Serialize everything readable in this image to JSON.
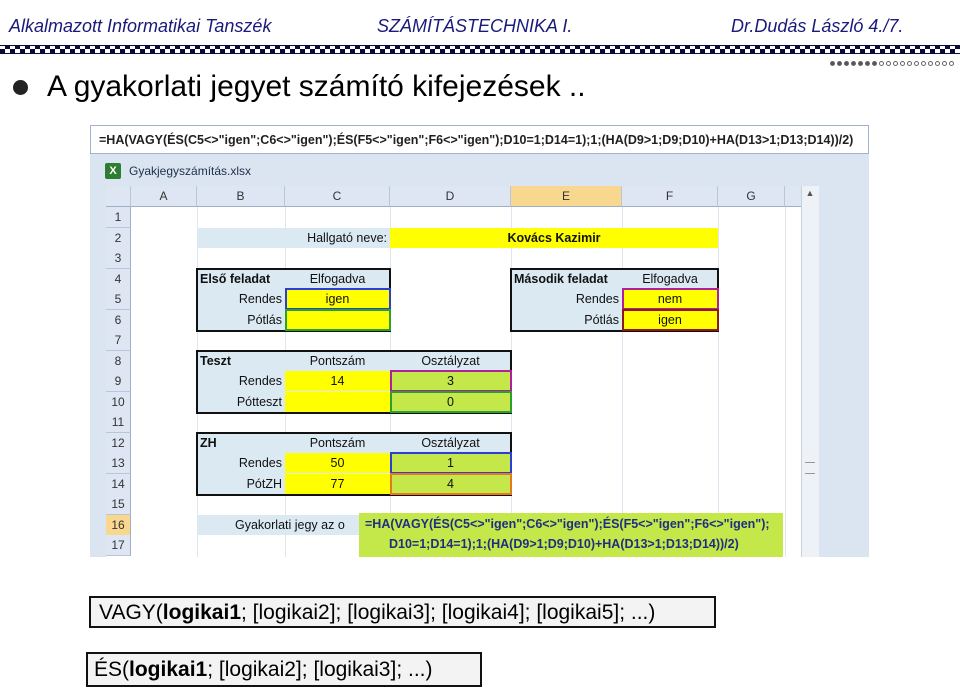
{
  "header": {
    "left": "Alkalmazott Informatikai Tanszék",
    "center": "SZÁMÍTÁSTECHNIKA I.",
    "right": "Dr.Dudás László   4./7."
  },
  "slide_title": "A gyakorlati jegyet számító kifejezések ..",
  "excel": {
    "formula_bar": "=HA(VAGY(ÉS(C5<>\"igen\";C6<>\"igen\");ÉS(F5<>\"igen\";F6<>\"igen\");D10=1;D14=1);1;(HA(D9>1;D9;D10)+HA(D13>1;D13;D14))/2)",
    "window_title": "Gyakjegyszámítás.xlsx",
    "columns": [
      "A",
      "B",
      "C",
      "D",
      "E",
      "F",
      "G"
    ],
    "rows": [
      "1",
      "2",
      "3",
      "4",
      "5",
      "6",
      "7",
      "8",
      "9",
      "10",
      "11",
      "12",
      "13",
      "14",
      "15",
      "16",
      "17"
    ],
    "cells": {
      "student_label": "Hallgató neve:",
      "student_name": "Kovács Kazimir",
      "first_task": "Első feladat",
      "accepted": "Elfogadva",
      "regular": "Rendes",
      "makeup": "Pótlás",
      "c5": "igen",
      "second_task": "Második feladat",
      "accepted2": "Elfogadva",
      "regular2": "Rendes",
      "makeup2": "Pótlás",
      "f5": "nem",
      "f6": "igen",
      "test": "Teszt",
      "points": "Pontszám",
      "grade": "Osztályzat",
      "test_regular": "Rendes",
      "test_makeup": "Pótteszt",
      "c9": "14",
      "d9": "3",
      "d10": "0",
      "zh": "ZH",
      "points2": "Pontszám",
      "grade2": "Osztályzat",
      "zh_regular": "Rendes",
      "zh_makeup": "PótZH",
      "c13": "50",
      "c14": "77",
      "d13": "1",
      "d14": "4",
      "practice_grade": "Gyakorlati jegy az o"
    },
    "formula_popup_line1": "=HA(VAGY(ÉS(C5<>\"igen\";C6<>\"igen\");ÉS(F5<>\"igen\";F6<>\"igen\");",
    "formula_popup_line2": "D10=1;D14=1);1;(HA(D9>1;D9;D10)+HA(D13>1;D13;D14))/2)"
  },
  "syntax": {
    "vagy_func": "VAGY(",
    "vagy_arg1": "logikai1",
    "vagy_rest": "; [logikai2]; [logikai3]; [logikai4]; [logikai5]; ...)",
    "es_func": "ÉS(",
    "es_arg1": "logikai1",
    "es_rest": "; [logikai2]; [logikai3]; ...)"
  },
  "colors": {
    "yellow": "#ffff00",
    "green": "#c4e84a",
    "light_blue": "#dbe9f3",
    "header_text": "#1a1a7a"
  }
}
